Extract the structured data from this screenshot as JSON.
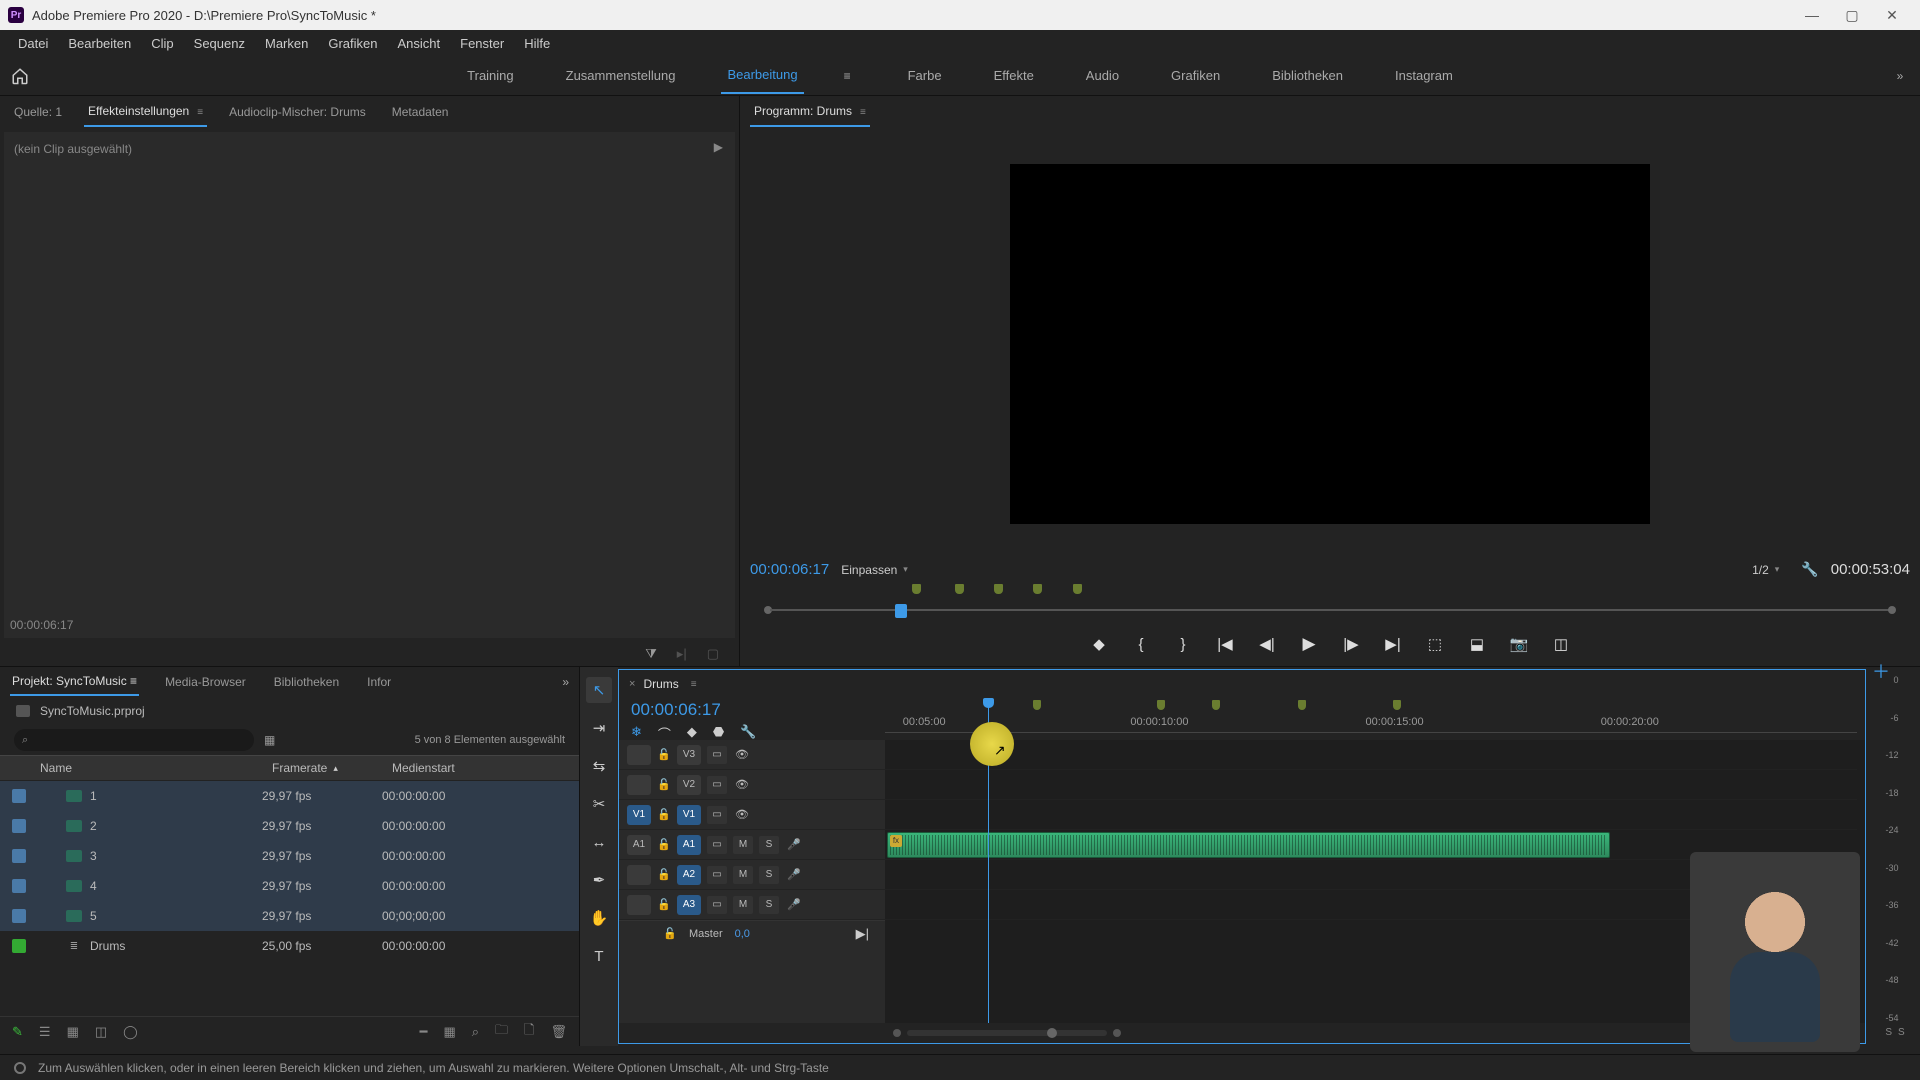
{
  "app": {
    "title": "Adobe Premiere Pro 2020 - D:\\Premiere Pro\\SyncToMusic *",
    "logo_text": "Pr"
  },
  "menu": [
    "Datei",
    "Bearbeiten",
    "Clip",
    "Sequenz",
    "Marken",
    "Grafiken",
    "Ansicht",
    "Fenster",
    "Hilfe"
  ],
  "workspaces": {
    "items": [
      "Training",
      "Zusammenstellung",
      "Bearbeitung",
      "Farbe",
      "Effekte",
      "Audio",
      "Grafiken",
      "Bibliotheken",
      "Instagram"
    ],
    "active_index": 2
  },
  "source_panel": {
    "tabs": [
      "Quelle: 1",
      "Effekteinstellungen",
      "Audioclip-Mischer: Drums",
      "Metadaten"
    ],
    "active_index": 1,
    "empty_text": "(kein Clip ausgewählt)",
    "footer_tc": "00:00:06:17"
  },
  "program": {
    "title": "Programm: Drums",
    "tc_current": "00:00:06:17",
    "fit_label": "Einpassen",
    "res_label": "1/2",
    "tc_duration": "00:00:53:04",
    "marker_percents": [
      13.5,
      17.2,
      20.6,
      24.0,
      27.5
    ],
    "playhead_percent": 12.0
  },
  "project": {
    "tabs": [
      "Projekt: SyncToMusic",
      "Media-Browser",
      "Bibliotheken",
      "Infor"
    ],
    "active_index": 0,
    "file_name": "SyncToMusic.prproj",
    "search_placeholder": "",
    "selection_text": "5 von 8 Elementen ausgewählt",
    "columns": {
      "name": "Name",
      "framerate": "Framerate",
      "medienstart": "Medienstart"
    },
    "rows": [
      {
        "name": "1",
        "fr": "29,97 fps",
        "ms": "00:00:00:00",
        "type": "clip",
        "selected": true
      },
      {
        "name": "2",
        "fr": "29,97 fps",
        "ms": "00:00:00:00",
        "type": "clip",
        "selected": true
      },
      {
        "name": "3",
        "fr": "29,97 fps",
        "ms": "00:00:00:00",
        "type": "clip",
        "selected": true
      },
      {
        "name": "4",
        "fr": "29,97 fps",
        "ms": "00:00:00:00",
        "type": "clip",
        "selected": true
      },
      {
        "name": "5",
        "fr": "29,97 fps",
        "ms": "00;00;00;00",
        "type": "clip",
        "selected": true
      },
      {
        "name": "Drums",
        "fr": "25,00 fps",
        "ms": "00:00:00:00",
        "type": "sequence",
        "selected": false
      }
    ]
  },
  "timeline": {
    "sequence_name": "Drums",
    "tc": "00:00:06:17",
    "ruler_ticks": [
      {
        "label": "00:05:00",
        "percent": 4
      },
      {
        "label": "00:00:10:00",
        "percent": 28
      },
      {
        "label": "00:00:15:00",
        "percent": 52
      },
      {
        "label": "00:00:20:00",
        "percent": 76
      }
    ],
    "markers_percent": [
      15.5,
      28.2,
      33.8,
      42.6,
      52.2
    ],
    "playhead_percent": 10.5,
    "tracks": {
      "video": [
        {
          "src": "",
          "tgt": "V3",
          "src_on": false,
          "tgt_on": false
        },
        {
          "src": "",
          "tgt": "V2",
          "src_on": false,
          "tgt_on": false
        },
        {
          "src": "V1",
          "tgt": "V1",
          "src_on": true,
          "tgt_on": true
        }
      ],
      "audio": [
        {
          "src": "A1",
          "tgt": "A1",
          "src_on": false,
          "tgt_on": true
        },
        {
          "src": "",
          "tgt": "A2",
          "src_on": false,
          "tgt_on": true
        },
        {
          "src": "",
          "tgt": "A3",
          "src_on": false,
          "tgt_on": true
        }
      ],
      "master_label": "Master",
      "master_value": "0,0"
    },
    "audio_clip": {
      "start_percent": 0.2,
      "end_percent": 74
    }
  },
  "meter": {
    "scale": [
      "0",
      "-6",
      "-12",
      "-18",
      "-24",
      "-30",
      "-36",
      "-42",
      "-48",
      "-54"
    ],
    "solo": [
      "S",
      "S"
    ]
  },
  "status": "Zum Auswählen klicken, oder in einen leeren Bereich klicken und ziehen, um Auswahl zu markieren. Weitere Optionen Umschalt-, Alt- und Strg-Taste"
}
